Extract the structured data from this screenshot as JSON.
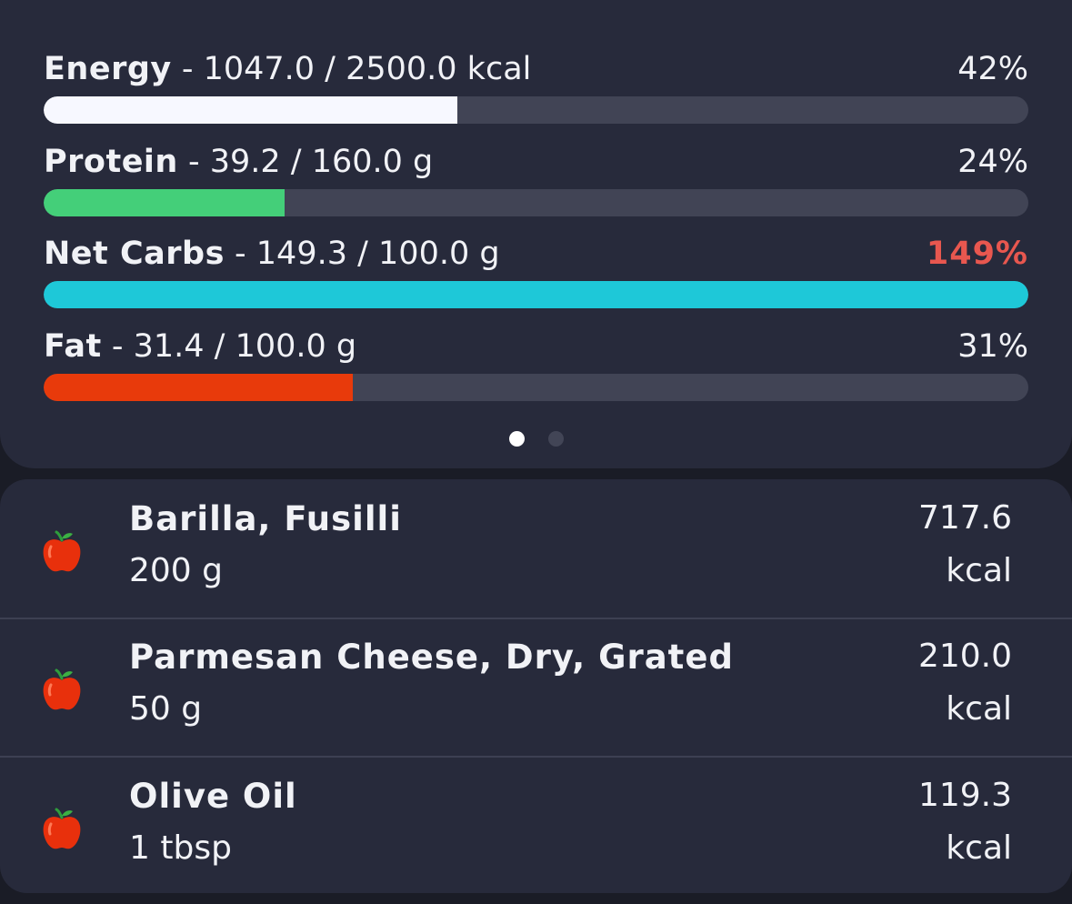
{
  "colors": {
    "energy": "#f7f8ff",
    "protein": "#44cf79",
    "net_carbs": "#1ec8d8",
    "fat": "#e83a0b",
    "over_goal": "#e8574f",
    "track": "#414455",
    "card": "#272a3b"
  },
  "nutrients": [
    {
      "name": "Energy",
      "detail": " - 1047.0 / 2500.0 kcal",
      "percent_label": "42%",
      "fill_fraction": 0.42
    },
    {
      "name": "Protein",
      "detail": " - 39.2 / 160.0 g",
      "percent_label": "24%",
      "fill_fraction": 0.245
    },
    {
      "name": "Net Carbs",
      "detail": " - 149.3 / 100.0 g",
      "percent_label": "149%",
      "fill_fraction": 1.0
    },
    {
      "name": "Fat",
      "detail": " - 31.4 / 100.0 g",
      "percent_label": "31%",
      "fill_fraction": 0.314
    }
  ],
  "pager": {
    "pages": 2,
    "active": 1
  },
  "foods": [
    {
      "name": "Barilla, Fusilli",
      "amount": "200 g",
      "kcal": "717.6",
      "unit": "kcal",
      "icon": "apple-icon"
    },
    {
      "name": "Parmesan Cheese, Dry, Grated",
      "amount": "50 g",
      "kcal": "210.0",
      "unit": "kcal",
      "icon": "apple-icon"
    },
    {
      "name": "Olive Oil",
      "amount": "1 tbsp",
      "kcal": "119.3",
      "unit": "kcal",
      "icon": "apple-icon"
    }
  ]
}
